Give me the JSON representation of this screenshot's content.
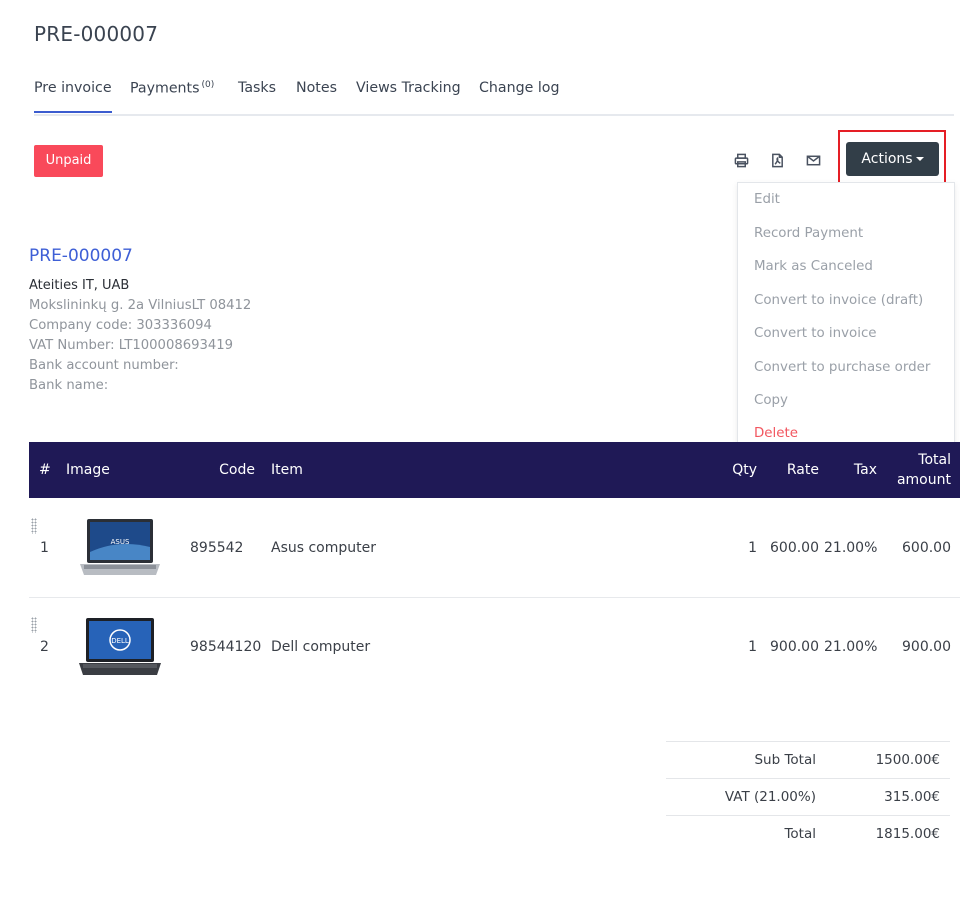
{
  "page": {
    "title": "PRE-000007"
  },
  "tabs": [
    {
      "label": "Pre invoice",
      "active": true
    },
    {
      "label": "Payments",
      "count": "(0)"
    },
    {
      "label": "Tasks"
    },
    {
      "label": "Notes"
    },
    {
      "label": "Views Tracking"
    },
    {
      "label": "Change log"
    }
  ],
  "status": {
    "label": "Unpaid",
    "color": "#f9495a"
  },
  "toolbar": {
    "icons": [
      "print-icon",
      "pdf-icon",
      "email-icon"
    ],
    "actions_label": "Actions",
    "highlight_color": "#e51e25"
  },
  "dropdown": {
    "items": [
      {
        "label": "Edit"
      },
      {
        "label": "Record Payment"
      },
      {
        "label": "Mark as Canceled"
      },
      {
        "label": "Convert to invoice (draft)"
      },
      {
        "label": "Convert to invoice"
      },
      {
        "label": "Convert to purchase order"
      },
      {
        "label": "Copy"
      },
      {
        "label": "Delete",
        "danger": true
      }
    ]
  },
  "document": {
    "number": "PRE-000007",
    "company": "Ateities IT, UAB",
    "address": "Mokslininkų g. 2a VilniusLT 08412",
    "company_code": "Company code: 303336094",
    "vat_number": "VAT Number: LT100008693419",
    "bank_account": "Bank account number:",
    "bank_name": "Bank name:"
  },
  "table": {
    "header_color": "#1f1956",
    "columns": {
      "num": "#",
      "image": "Image",
      "code": "Code",
      "item": "Item",
      "qty": "Qty",
      "rate": "Rate",
      "tax": "Tax",
      "total_line1": "Total",
      "total_line2": "amount"
    },
    "rows": [
      {
        "num": "1",
        "image": "asus-laptop-image",
        "code": "895542",
        "item": "Asus computer",
        "qty": "1",
        "rate": "600.00",
        "tax": "21.00%",
        "total": "600.00"
      },
      {
        "num": "2",
        "image": "dell-laptop-image",
        "code": "98544120",
        "item": "Dell computer",
        "qty": "1",
        "rate": "900.00",
        "tax": "21.00%",
        "total": "900.00"
      }
    ]
  },
  "totals": {
    "subtotal_label": "Sub Total",
    "subtotal_value": "1500.00€",
    "vat_label": "VAT (21.00%)",
    "vat_value": "315.00€",
    "total_label": "Total",
    "total_value": "1815.00€"
  }
}
